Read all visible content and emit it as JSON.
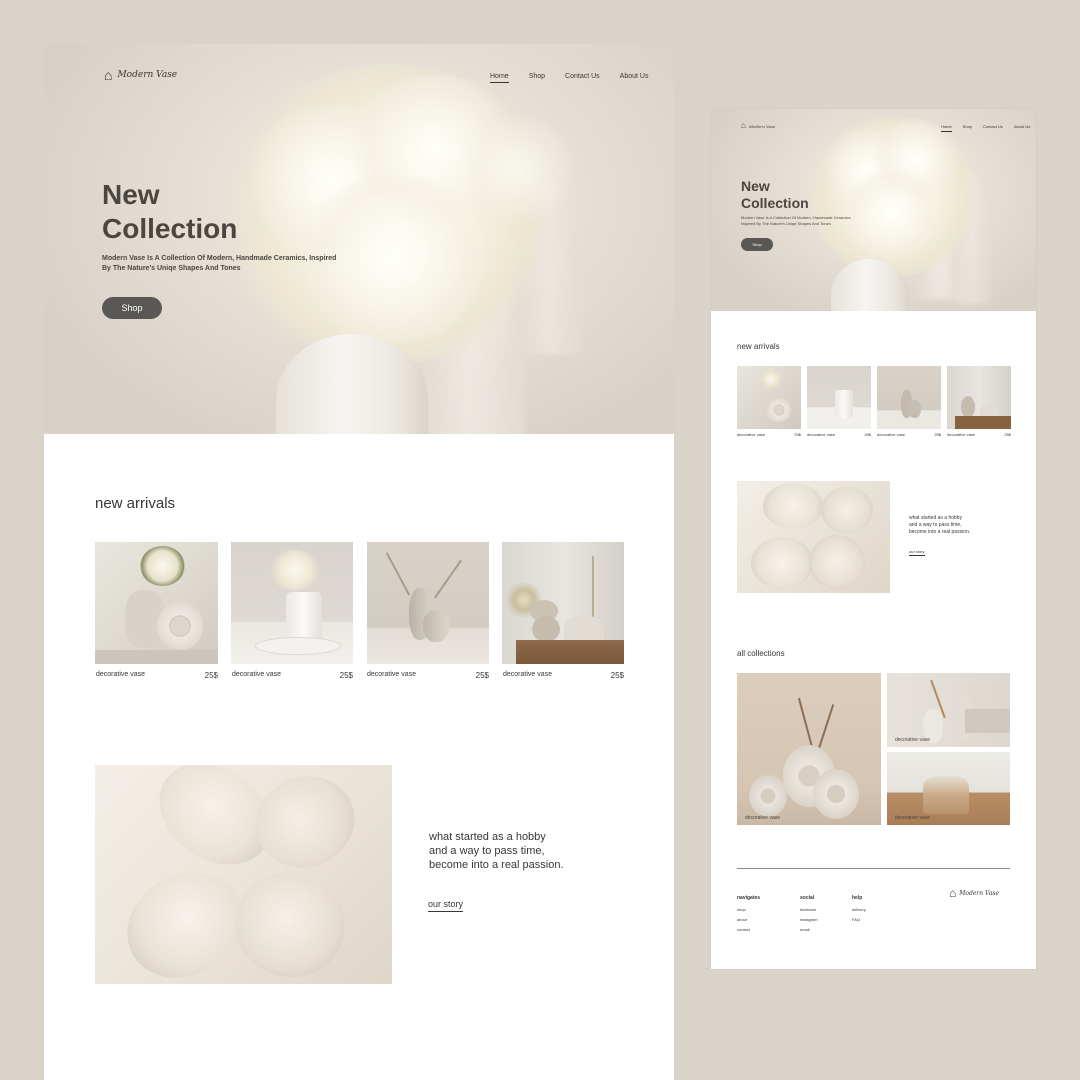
{
  "brand": {
    "name": "Modern Vase"
  },
  "nav": {
    "items": [
      "Home",
      "Shop",
      "Contact Us",
      "About Us"
    ],
    "active": "Home"
  },
  "hero": {
    "title_line1": "New",
    "title_line2": "Collection",
    "subtitle": "Modern Vase Is A Collection Of Modern, Handmade Ceramics, Inspired By The Nature's Uniqe Shapes And Tones",
    "button": "Shop"
  },
  "new_arrivals": {
    "title": "new arrivals",
    "products": [
      {
        "name": "decorative vase",
        "price": "25$"
      },
      {
        "name": "decorative vase",
        "price": "25$"
      },
      {
        "name": "decorative vase",
        "price": "25$"
      },
      {
        "name": "decorative vase",
        "price": "25$"
      }
    ]
  },
  "story": {
    "line1": "what started as a hobby",
    "line2": "and a way to pass time,",
    "line3": "become into a real passion.",
    "link": "our story"
  },
  "all_collections": {
    "title": "all collections",
    "items": [
      {
        "label": "decorative vase"
      },
      {
        "label": "decorative vase"
      },
      {
        "label": "decorative vase"
      }
    ]
  },
  "footer": {
    "columns": [
      {
        "heading": "navigates",
        "items": [
          "shop",
          "about",
          "contact"
        ]
      },
      {
        "heading": "social",
        "items": [
          "facebook",
          "instagram",
          "email"
        ]
      },
      {
        "heading": "help",
        "items": [
          "delivery",
          "FAQ"
        ]
      }
    ]
  },
  "colors": {
    "page_bg": "#d9d3c9",
    "dark_button": "#5a5854",
    "text": "#3a3733"
  }
}
